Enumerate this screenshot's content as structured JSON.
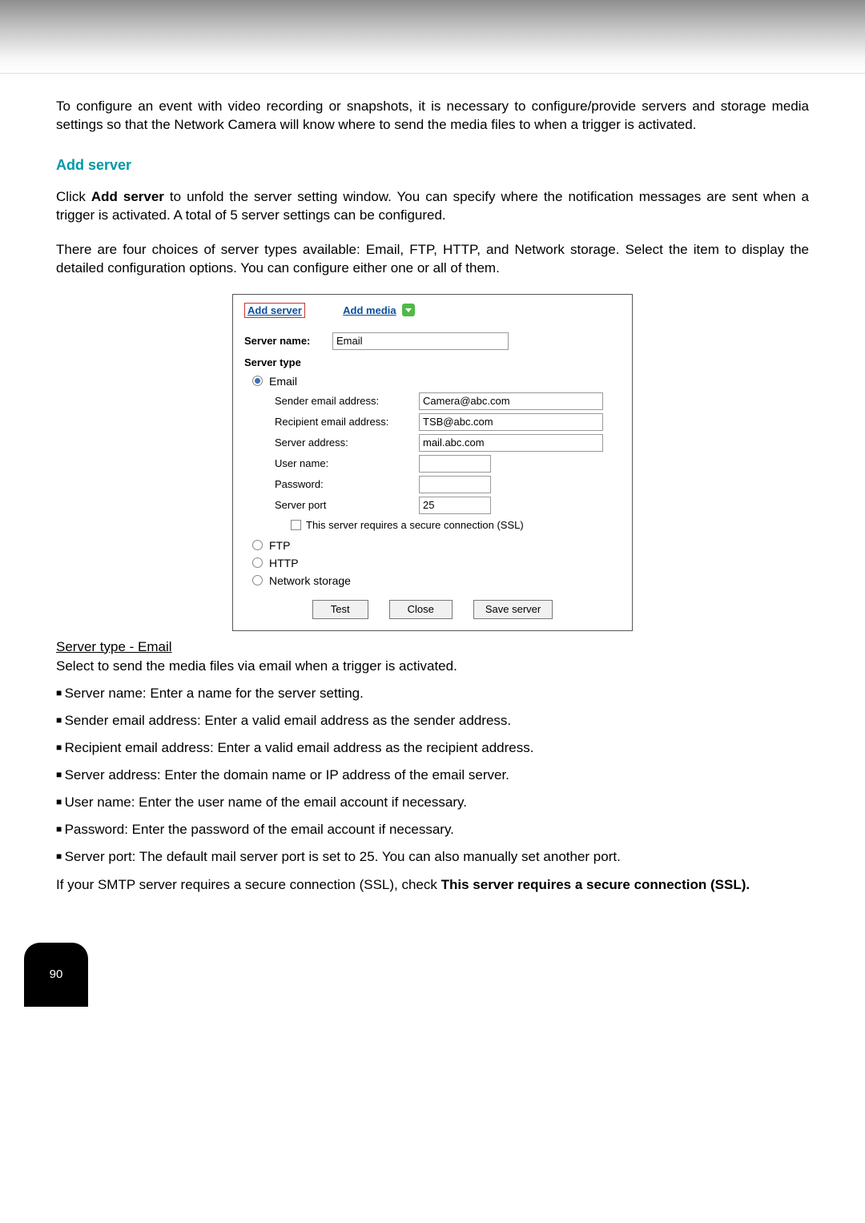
{
  "intro": "To configure an event with video recording or snapshots, it is necessary to configure/provide servers and storage media settings so that the Network Camera will know where to send the media files to when a trigger is activated.",
  "section_heading": "Add server",
  "para1_a": "Click ",
  "para1_b": "Add server",
  "para1_c": " to unfold the server setting window. You can specify where the notification messages are sent when a trigger is activated. A total of 5 server settings can be configured.",
  "para2": "There are four choices of server types available: Email, FTP, HTTP, and Network storage. Select the item to display the detailed configuration options. You can configure either one or all of them.",
  "dialog": {
    "tab_add_server": "Add server",
    "tab_add_media": "Add media",
    "server_name_label": "Server name:",
    "server_name_value": "Email",
    "server_type_header": "Server type",
    "radios": {
      "email": "Email",
      "ftp": "FTP",
      "http": "HTTP",
      "network_storage": "Network storage"
    },
    "fields": {
      "sender_label": "Sender email address:",
      "sender_value": "Camera@abc.com",
      "recipient_label": "Recipient email address:",
      "recipient_value": "TSB@abc.com",
      "server_addr_label": "Server address:",
      "server_addr_value": "mail.abc.com",
      "username_label": "User name:",
      "username_value": "",
      "password_label": "Password:",
      "password_value": "",
      "server_port_label": "Server port",
      "server_port_value": "25",
      "ssl_label": "This server requires a secure connection (SSL)"
    },
    "buttons": {
      "test": "Test",
      "close": "Close",
      "save": "Save server"
    }
  },
  "subhead": "Server type - Email",
  "subdesc": "Select to send the media files via email when a trigger is activated.",
  "bullets": [
    "Server name: Enter a name for the server setting.",
    "Sender email address: Enter a valid email address as the sender address.",
    "Recipient email address: Enter a valid email address as the recipient address.",
    "Server address: Enter the domain name or IP address of the email server.",
    "User name: Enter the user name of the email account if necessary.",
    "Password: Enter the password of the email account if necessary.",
    "Server port: The default mail server port is set to 25. You can also manually set another port."
  ],
  "tail_a": "If your SMTP server requires a secure connection (SSL), check ",
  "tail_b": "This server requires a secure connection (SSL).",
  "page_number": "90"
}
